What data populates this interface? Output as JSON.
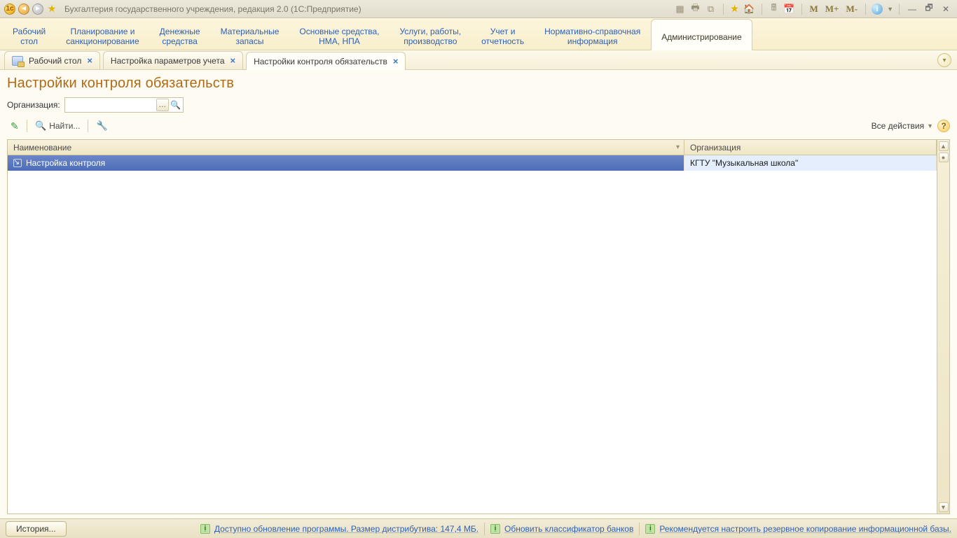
{
  "window": {
    "title": "Бухгалтерия государственного учреждения, редакция 2.0  (1С:Предприятие)",
    "memory_buttons": [
      "M",
      "M+",
      "M-"
    ]
  },
  "sections": [
    "Рабочий\nстол",
    "Планирование и\nсанкционирование",
    "Денежные\nсредства",
    "Материальные\nзапасы",
    "Основные средства,\nНМА, НПА",
    "Услуги, работы,\nпроизводство",
    "Учет и\nотчетность",
    "Нормативно-справочная\nинформация",
    "Администрирование"
  ],
  "sections_active_index": 8,
  "page_tabs": [
    {
      "label": "Рабочий стол",
      "has_icon": true
    },
    {
      "label": "Настройка параметров учета",
      "has_icon": false
    },
    {
      "label": "Настройки контроля обязательств",
      "has_icon": false
    }
  ],
  "page_tabs_active_index": 2,
  "page": {
    "title": "Настройки контроля обязательств",
    "org_label": "Организация:",
    "org_value": "",
    "find_label": "Найти...",
    "all_actions_label": "Все действия"
  },
  "grid": {
    "columns": [
      "Наименование",
      "Организация"
    ],
    "rows": [
      {
        "name": "Настройка контроля",
        "org": "КГТУ \"Музыкальная школа\""
      }
    ],
    "selected_index": 0
  },
  "status": {
    "history_label": "История...",
    "items": [
      "Доступно обновление программы. Размер дистрибутива: 147,4 МБ.",
      "Обновить классификатор банков",
      "Рекомендуется настроить резервное копирование информационной базы."
    ]
  }
}
